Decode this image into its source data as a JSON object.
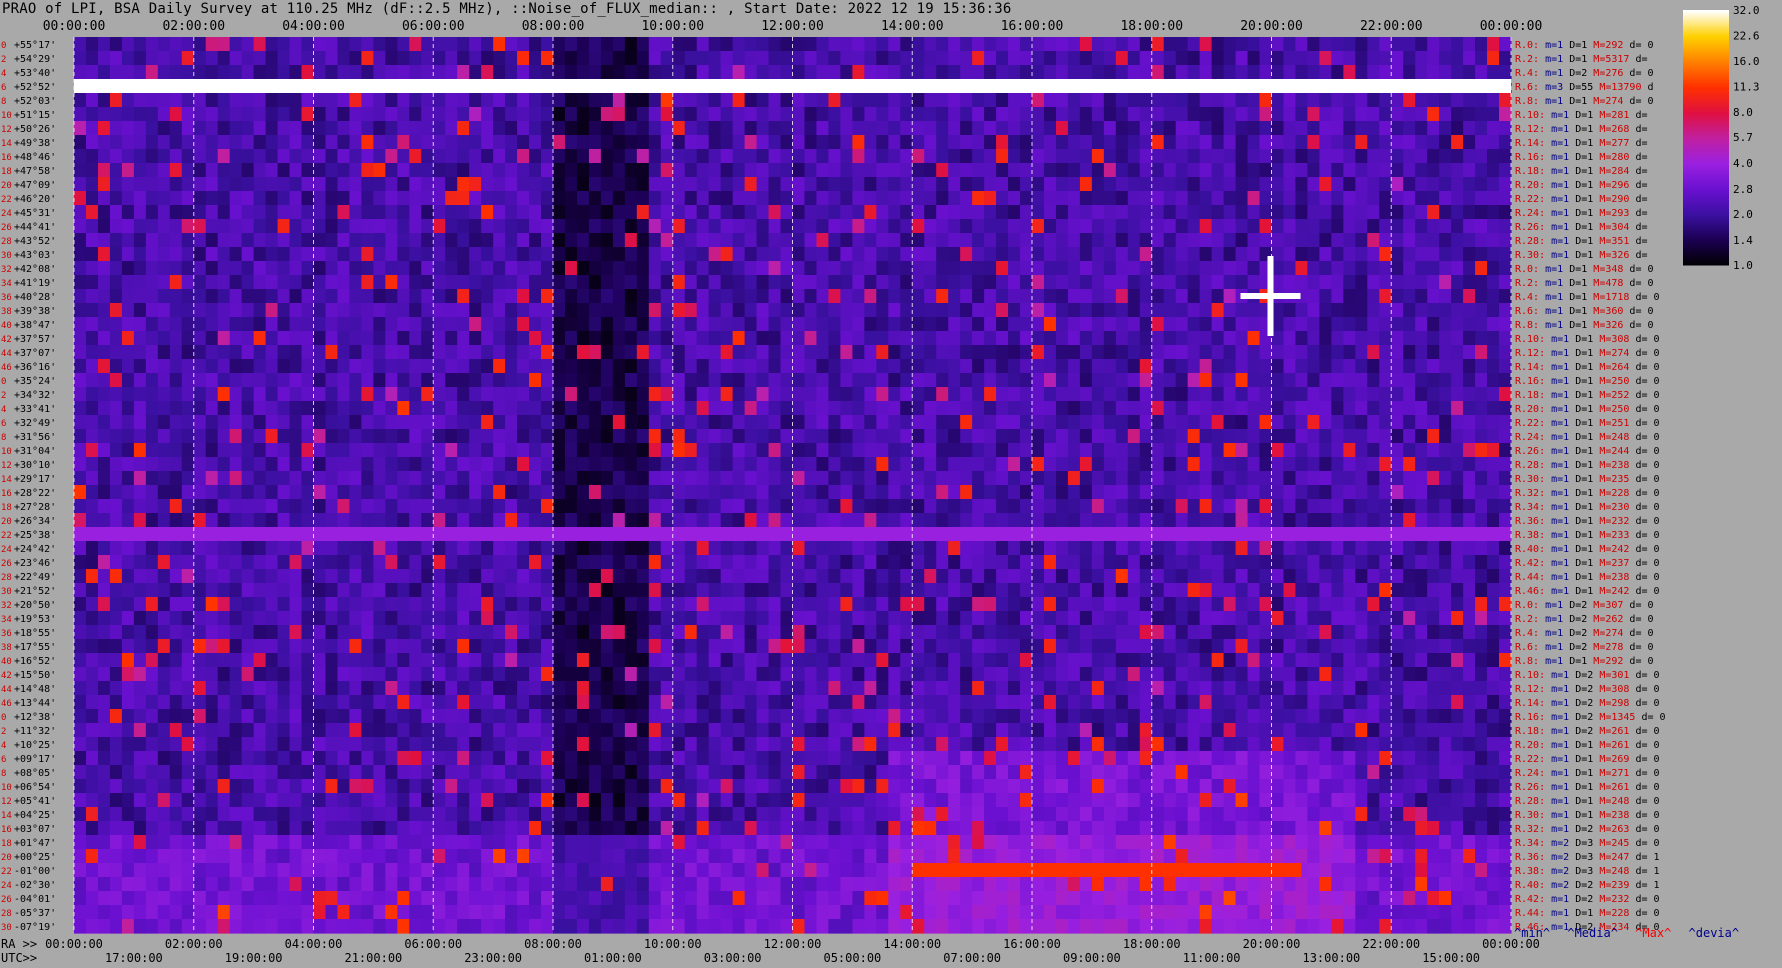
{
  "title": "PRAO of LPI, BSA Daily Survey at 110.25 MHz (dF::2.5 MHz), ::Noise_of_FLUX_median:: , Start Date: 2022 12 19 15:36:36",
  "chart_data": {
    "type": "heatmap",
    "top_axis_ticks": [
      "00:00:00",
      "02:00:00",
      "04:00:00",
      "06:00:00",
      "08:00:00",
      "10:00:00",
      "12:00:00",
      "14:00:00",
      "16:00:00",
      "18:00:00",
      "20:00:00",
      "22:00:00",
      "00:00:00"
    ],
    "ra_axis_label": "RA >>",
    "ra_ticks": [
      "00:00:00",
      "02:00:00",
      "04:00:00",
      "06:00:00",
      "08:00:00",
      "10:00:00",
      "12:00:00",
      "14:00:00",
      "16:00:00",
      "18:00:00",
      "20:00:00",
      "22:00:00",
      "00:00:00"
    ],
    "utc_axis_label": "UTC>>",
    "utc_ticks": [
      "17:00:00",
      "19:00:00",
      "21:00:00",
      "23:00:00",
      "01:00:00",
      "03:00:00",
      "05:00:00",
      "07:00:00",
      "09:00:00",
      "11:00:00",
      "13:00:00",
      "15:00:00"
    ],
    "beam_index": [
      "0",
      "2",
      "4",
      "6",
      "8",
      "10",
      "12",
      "14",
      "16",
      "18",
      "20",
      "22",
      "24",
      "26",
      "28",
      "30",
      "32",
      "34",
      "36",
      "38",
      "40",
      "42",
      "44",
      "46",
      "0",
      "2",
      "4",
      "6",
      "8",
      "10",
      "12",
      "14",
      "16",
      "18",
      "20",
      "22",
      "24",
      "26",
      "28",
      "30",
      "32",
      "34",
      "36",
      "38",
      "40",
      "42",
      "44",
      "46",
      "0",
      "2",
      "4",
      "6",
      "8",
      "10",
      "12",
      "14",
      "16",
      "18",
      "20",
      "22",
      "24",
      "26",
      "28",
      "30",
      "32",
      "34",
      "36",
      "38",
      "40",
      "42",
      "44",
      "46"
    ],
    "declinations": [
      "+55°17'",
      "+54°29'",
      "+53°40'",
      "+52°52'",
      "+52°03'",
      "+51°15'",
      "+50°26'",
      "+49°38'",
      "+48°46'",
      "+47°58'",
      "+47°09'",
      "+46°20'",
      "+45°31'",
      "+44°41'",
      "+43°52'",
      "+43°03'",
      "+42°08'",
      "+41°19'",
      "+40°28'",
      "+39°38'",
      "+38°47'",
      "+37°57'",
      "+37°07'",
      "+36°16'",
      "+35°24'",
      "+34°32'",
      "+33°41'",
      "+32°49'",
      "+31°56'",
      "+31°04'",
      "+30°10'",
      "+29°17'",
      "+28°22'",
      "+27°28'",
      "+26°34'",
      "+25°38'",
      "+24°42'",
      "+23°46'",
      "+22°49'",
      "+21°52'",
      "+20°50'",
      "+19°53'",
      "+18°55'",
      "+17°55'",
      "+16°52'",
      "+15°50'",
      "+14°48'",
      "+13°44'",
      "+12°38'",
      "+11°32'",
      "+10°25'",
      "+09°17'",
      "+08°05'",
      "+06°54'",
      "+05°41'",
      "+04°25'",
      "+03°07'",
      "+01°47'",
      "+00°25'",
      "-01°00'",
      "-02°30'",
      "-04°01'",
      "-05°37'",
      "-07°19'"
    ],
    "right_stats": [
      {
        "r": "R.0:",
        "m": "m=1",
        "d": "D=1",
        "mx": "M=292",
        "dv": "d= 0"
      },
      {
        "r": "R.2:",
        "m": "m=1",
        "d": "D=1",
        "mx": "M=5317",
        "dv": "d="
      },
      {
        "r": "R.4:",
        "m": "m=1",
        "d": "D=2",
        "mx": "M=276",
        "dv": "d= 0"
      },
      {
        "r": "R.6:",
        "m": "m=3",
        "d": "D=55",
        "mx": "M=13790",
        "dv": "d"
      },
      {
        "r": "R.8:",
        "m": "m=1",
        "d": "D=1",
        "mx": "M=274",
        "dv": "d= 0"
      },
      {
        "r": "R.10:",
        "m": "m=1",
        "d": "D=1",
        "mx": "M=281",
        "dv": "d="
      },
      {
        "r": "R.12:",
        "m": "m=1",
        "d": "D=1",
        "mx": "M=268",
        "dv": "d="
      },
      {
        "r": "R.14:",
        "m": "m=1",
        "d": "D=1",
        "mx": "M=277",
        "dv": "d="
      },
      {
        "r": "R.16:",
        "m": "m=1",
        "d": "D=1",
        "mx": "M=280",
        "dv": "d="
      },
      {
        "r": "R.18:",
        "m": "m=1",
        "d": "D=1",
        "mx": "M=284",
        "dv": "d="
      },
      {
        "r": "R.20:",
        "m": "m=1",
        "d": "D=1",
        "mx": "M=296",
        "dv": "d="
      },
      {
        "r": "R.22:",
        "m": "m=1",
        "d": "D=1",
        "mx": "M=290",
        "dv": "d="
      },
      {
        "r": "R.24:",
        "m": "m=1",
        "d": "D=1",
        "mx": "M=293",
        "dv": "d="
      },
      {
        "r": "R.26:",
        "m": "m=1",
        "d": "D=1",
        "mx": "M=304",
        "dv": "d="
      },
      {
        "r": "R.28:",
        "m": "m=1",
        "d": "D=1",
        "mx": "M=351",
        "dv": "d="
      },
      {
        "r": "R.30:",
        "m": "m=1",
        "d": "D=1",
        "mx": "M=326",
        "dv": "d="
      },
      {
        "r": "R.0:",
        "m": "m=1",
        "d": "D=1",
        "mx": "M=348",
        "dv": "d= 0"
      },
      {
        "r": "R.2:",
        "m": "m=1",
        "d": "D=1",
        "mx": "M=478",
        "dv": "d= 0"
      },
      {
        "r": "R.4:",
        "m": "m=1",
        "d": "D=1",
        "mx": "M=1718",
        "dv": "d= 0"
      },
      {
        "r": "R.6:",
        "m": "m=1",
        "d": "D=1",
        "mx": "M=360",
        "dv": "d= 0"
      },
      {
        "r": "R.8:",
        "m": "m=1",
        "d": "D=1",
        "mx": "M=326",
        "dv": "d= 0"
      },
      {
        "r": "R.10:",
        "m": "m=1",
        "d": "D=1",
        "mx": "M=308",
        "dv": "d= 0"
      },
      {
        "r": "R.12:",
        "m": "m=1",
        "d": "D=1",
        "mx": "M=274",
        "dv": "d= 0"
      },
      {
        "r": "R.14:",
        "m": "m=1",
        "d": "D=1",
        "mx": "M=264",
        "dv": "d= 0"
      },
      {
        "r": "R.16:",
        "m": "m=1",
        "d": "D=1",
        "mx": "M=250",
        "dv": "d= 0"
      },
      {
        "r": "R.18:",
        "m": "m=1",
        "d": "D=1",
        "mx": "M=252",
        "dv": "d= 0"
      },
      {
        "r": "R.20:",
        "m": "m=1",
        "d": "D=1",
        "mx": "M=250",
        "dv": "d= 0"
      },
      {
        "r": "R.22:",
        "m": "m=1",
        "d": "D=1",
        "mx": "M=251",
        "dv": "d= 0"
      },
      {
        "r": "R.24:",
        "m": "m=1",
        "d": "D=1",
        "mx": "M=248",
        "dv": "d= 0"
      },
      {
        "r": "R.26:",
        "m": "m=1",
        "d": "D=1",
        "mx": "M=244",
        "dv": "d= 0"
      },
      {
        "r": "R.28:",
        "m": "m=1",
        "d": "D=1",
        "mx": "M=238",
        "dv": "d= 0"
      },
      {
        "r": "R.30:",
        "m": "m=1",
        "d": "D=1",
        "mx": "M=235",
        "dv": "d= 0"
      },
      {
        "r": "R.32:",
        "m": "m=1",
        "d": "D=1",
        "mx": "M=228",
        "dv": "d= 0"
      },
      {
        "r": "R.34:",
        "m": "m=1",
        "d": "D=1",
        "mx": "M=230",
        "dv": "d= 0"
      },
      {
        "r": "R.36:",
        "m": "m=1",
        "d": "D=1",
        "mx": "M=232",
        "dv": "d= 0"
      },
      {
        "r": "R.38:",
        "m": "m=1",
        "d": "D=1",
        "mx": "M=233",
        "dv": "d= 0"
      },
      {
        "r": "R.40:",
        "m": "m=1",
        "d": "D=1",
        "mx": "M=242",
        "dv": "d= 0"
      },
      {
        "r": "R.42:",
        "m": "m=1",
        "d": "D=1",
        "mx": "M=237",
        "dv": "d= 0"
      },
      {
        "r": "R.44:",
        "m": "m=1",
        "d": "D=1",
        "mx": "M=238",
        "dv": "d= 0"
      },
      {
        "r": "R.46:",
        "m": "m=1",
        "d": "D=1",
        "mx": "M=242",
        "dv": "d= 0"
      },
      {
        "r": "R.0:",
        "m": "m=1",
        "d": "D=2",
        "mx": "M=307",
        "dv": "d= 0"
      },
      {
        "r": "R.2:",
        "m": "m=1",
        "d": "D=2",
        "mx": "M=262",
        "dv": "d= 0"
      },
      {
        "r": "R.4:",
        "m": "m=1",
        "d": "D=2",
        "mx": "M=274",
        "dv": "d= 0"
      },
      {
        "r": "R.6:",
        "m": "m=1",
        "d": "D=2",
        "mx": "M=278",
        "dv": "d= 0"
      },
      {
        "r": "R.8:",
        "m": "m=1",
        "d": "D=1",
        "mx": "M=292",
        "dv": "d= 0"
      },
      {
        "r": "R.10:",
        "m": "m=1",
        "d": "D=2",
        "mx": "M=301",
        "dv": "d= 0"
      },
      {
        "r": "R.12:",
        "m": "m=1",
        "d": "D=2",
        "mx": "M=308",
        "dv": "d= 0"
      },
      {
        "r": "R.14:",
        "m": "m=1",
        "d": "D=2",
        "mx": "M=298",
        "dv": "d= 0"
      },
      {
        "r": "R.16:",
        "m": "m=1",
        "d": "D=2",
        "mx": "M=1345",
        "dv": "d= 0"
      },
      {
        "r": "R.18:",
        "m": "m=1",
        "d": "D=2",
        "mx": "M=261",
        "dv": "d= 0"
      },
      {
        "r": "R.20:",
        "m": "m=1",
        "d": "D=1",
        "mx": "M=261",
        "dv": "d= 0"
      },
      {
        "r": "R.22:",
        "m": "m=1",
        "d": "D=1",
        "mx": "M=269",
        "dv": "d= 0"
      },
      {
        "r": "R.24:",
        "m": "m=1",
        "d": "D=1",
        "mx": "M=271",
        "dv": "d= 0"
      },
      {
        "r": "R.26:",
        "m": "m=1",
        "d": "D=1",
        "mx": "M=261",
        "dv": "d= 0"
      },
      {
        "r": "R.28:",
        "m": "m=1",
        "d": "D=1",
        "mx": "M=248",
        "dv": "d= 0"
      },
      {
        "r": "R.30:",
        "m": "m=1",
        "d": "D=1",
        "mx": "M=238",
        "dv": "d= 0"
      },
      {
        "r": "R.32:",
        "m": "m=1",
        "d": "D=2",
        "mx": "M=263",
        "dv": "d= 0"
      },
      {
        "r": "R.34:",
        "m": "m=2",
        "d": "D=3",
        "mx": "M=245",
        "dv": "d= 0"
      },
      {
        "r": "R.36:",
        "m": "m=2",
        "d": "D=3",
        "mx": "M=247",
        "dv": "d= 1"
      },
      {
        "r": "R.38:",
        "m": "m=2",
        "d": "D=3",
        "mx": "M=248",
        "dv": "d= 1"
      },
      {
        "r": "R.40:",
        "m": "m=2",
        "d": "D=2",
        "mx": "M=239",
        "dv": "d= 1"
      },
      {
        "r": "R.42:",
        "m": "m=1",
        "d": "D=2",
        "mx": "M=232",
        "dv": "d= 0"
      },
      {
        "r": "R.44:",
        "m": "m=1",
        "d": "D=1",
        "mx": "M=228",
        "dv": "d= 0"
      },
      {
        "r": "R.46:",
        "m": "m=1",
        "d": "D=2",
        "mx": "M=234",
        "dv": "d= 0"
      }
    ],
    "colorbar_ticks": [
      "32.0",
      "22.6",
      "16.0",
      "11.3",
      "8.0",
      "5.7",
      "4.0",
      "2.8",
      "2.0",
      "1.4",
      "1.0"
    ],
    "colorbar_scale": "log",
    "colorbar_range": [
      1.0,
      32.0
    ],
    "colormap": [
      "#000000",
      "#1a0050",
      "#3a10a0",
      "#6a10d0",
      "#9a20e0",
      "#c020a0",
      "#e01040",
      "#ff3000",
      "#ff8000",
      "#ffd000",
      "#ffffff"
    ],
    "features": [
      {
        "name": "bright horizontal band",
        "dec": "+52°52'",
        "ra_range": [
          "00:00:00",
          "24:00:00"
        ],
        "level": 32.0
      },
      {
        "name": "horizontal band",
        "dec": "+25°38'",
        "ra_range": [
          "00:00:00",
          "24:00:00"
        ],
        "level": 4.0
      },
      {
        "name": "Sun",
        "dec": "-01°00'",
        "ra_range": [
          "14:00:00",
          "20:30:00"
        ],
        "level": 11.3
      },
      {
        "name": "Cyg A",
        "dec": "+40°28'",
        "ra": "19:59:00",
        "level": 32.0
      }
    ]
  },
  "bottom_legend": {
    "min": "^min^",
    "median": "^Media^",
    "max": "^Max^",
    "devia": "^devia^"
  }
}
